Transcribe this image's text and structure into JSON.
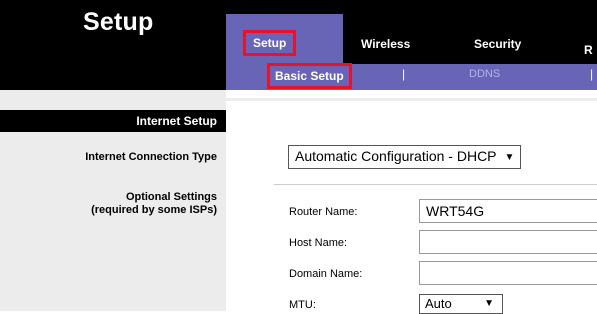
{
  "header": {
    "page_title": "Setup"
  },
  "tabs": {
    "setup": "Setup",
    "wireless": "Wireless",
    "security": "Security",
    "more": "R"
  },
  "subtabs": {
    "basic_setup": "Basic Setup",
    "separator": "|",
    "ddns": "DDNS"
  },
  "sidebar": {
    "section_title": "Internet Setup",
    "connection_type_label": "Internet Connection Type",
    "optional_settings_line1": "Optional Settings",
    "optional_settings_line2": "(required by some ISPs)"
  },
  "form": {
    "connection_type_value": "Automatic Configuration - DHCP",
    "router_name_label": "Router Name:",
    "router_name_value": "WRT54G",
    "host_name_label": "Host Name:",
    "host_name_value": "",
    "domain_name_label": "Domain Name:",
    "domain_name_value": "",
    "mtu_label": "MTU:",
    "mtu_value": "Auto"
  },
  "colors": {
    "brand_purple": "#6865b7",
    "highlight_red": "#e8132a",
    "sidebar_gray": "#ececec"
  }
}
